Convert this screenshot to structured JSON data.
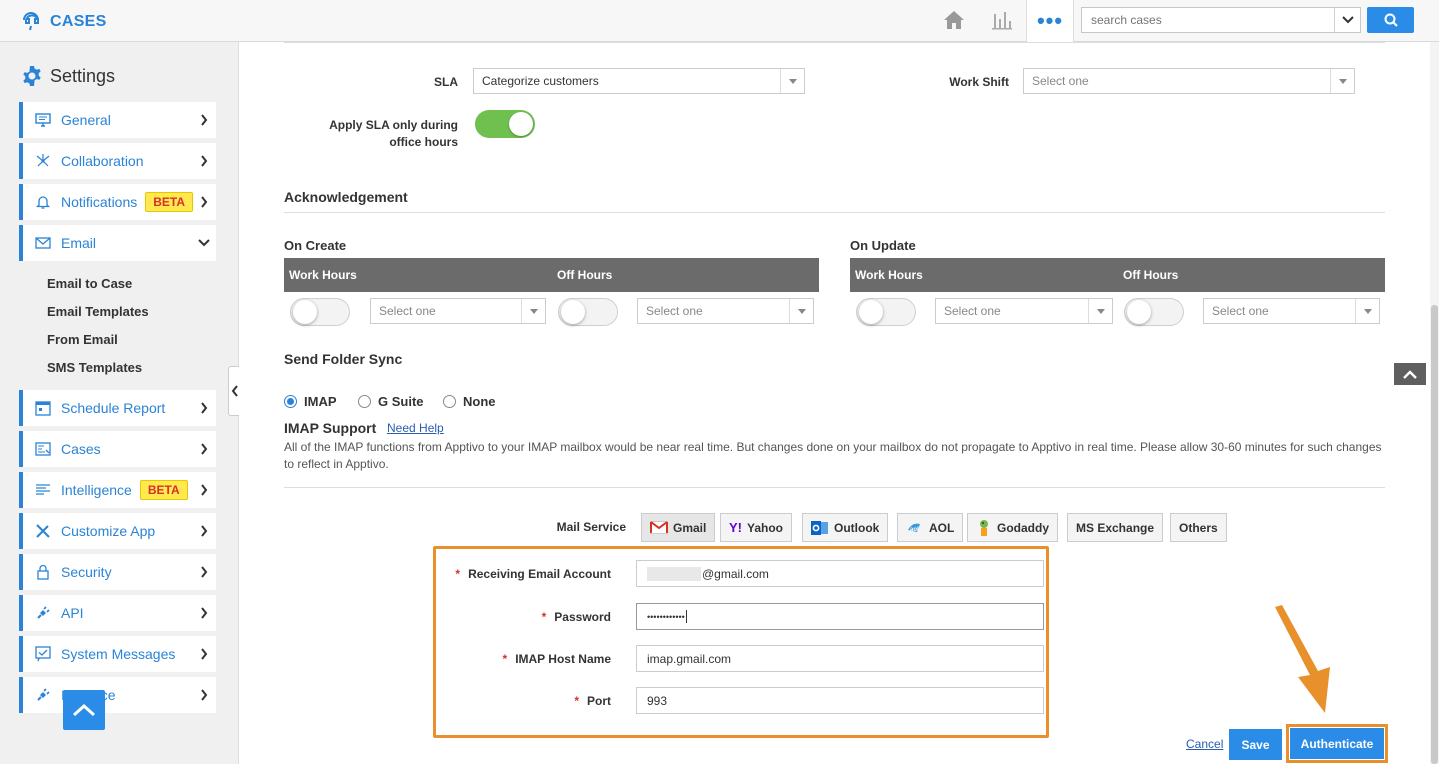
{
  "app": {
    "title": "CASES"
  },
  "header": {
    "search_placeholder": "search cases",
    "more_label": "•••"
  },
  "sidebar": {
    "title": "Settings",
    "items": [
      {
        "label": "General",
        "icon": "monitor-icon",
        "beta": ""
      },
      {
        "label": "Collaboration",
        "icon": "network-icon",
        "beta": ""
      },
      {
        "label": "Notifications",
        "icon": "bell-icon",
        "beta": "BETA"
      },
      {
        "label": "Email",
        "icon": "envelope-icon",
        "beta": ""
      },
      {
        "label": "Schedule Report",
        "icon": "calendar-icon",
        "beta": ""
      },
      {
        "label": "Cases",
        "icon": "cases-icon",
        "beta": ""
      },
      {
        "label": "Intelligence",
        "icon": "list-icon",
        "beta": "BETA"
      },
      {
        "label": "Customize App",
        "icon": "tools-icon",
        "beta": ""
      },
      {
        "label": "Security",
        "icon": "lock-icon",
        "beta": ""
      },
      {
        "label": "API",
        "icon": "plug-icon",
        "beta": ""
      },
      {
        "label": "System Messages",
        "icon": "message-check-icon",
        "beta": ""
      },
      {
        "label": "Interface",
        "icon": "plug-icon",
        "beta": ""
      }
    ],
    "email_sub": [
      "Email to Case",
      "Email Templates",
      "From Email",
      "SMS Templates"
    ]
  },
  "sla": {
    "sla_label": "SLA",
    "sla_value": "Categorize customers",
    "workshift_label": "Work Shift",
    "workshift_placeholder": "Select one",
    "apply_label_line1": "Apply SLA only during",
    "apply_label_line2": "office hours",
    "apply_on": true
  },
  "ack": {
    "title": "Acknowledgement",
    "on_create": "On Create",
    "on_update": "On Update",
    "work_hours": "Work Hours",
    "off_hours": "Off Hours",
    "select_placeholder": "Select one"
  },
  "sync": {
    "title": "Send Folder Sync",
    "options": [
      "IMAP",
      "G Suite",
      "None"
    ],
    "selected": "IMAP",
    "support_title": "IMAP Support",
    "help_link": "Need Help",
    "note": "All of the IMAP functions from Apptivo to your IMAP mailbox would be near real time. But changes done on your mailbox do not propagate to Apptivo in real time. Please allow 30-60 minutes for such changes to reflect in Apptivo."
  },
  "mail_service": {
    "label": "Mail Service",
    "options": [
      "Gmail",
      "Yahoo",
      "Outlook",
      "AOL",
      "Godaddy",
      "MS Exchange",
      "Others"
    ],
    "selected": "Gmail"
  },
  "form": {
    "receiving_label": "Receiving Email Account",
    "receiving_value": "@gmail.com",
    "password_label": "Password",
    "password_value": "••••••••••••",
    "imap_host_label": "IMAP Host Name",
    "imap_host_value": "imap.gmail.com",
    "port_label": "Port",
    "port_value": "993",
    "required_mark": "*"
  },
  "actions": {
    "cancel": "Cancel",
    "save": "Save",
    "authenticate": "Authenticate"
  },
  "colors": {
    "accent": "#2a83d6",
    "highlight": "#e8912c",
    "toggle_on": "#6fc04f",
    "beta_bg": "#ffe94f"
  }
}
